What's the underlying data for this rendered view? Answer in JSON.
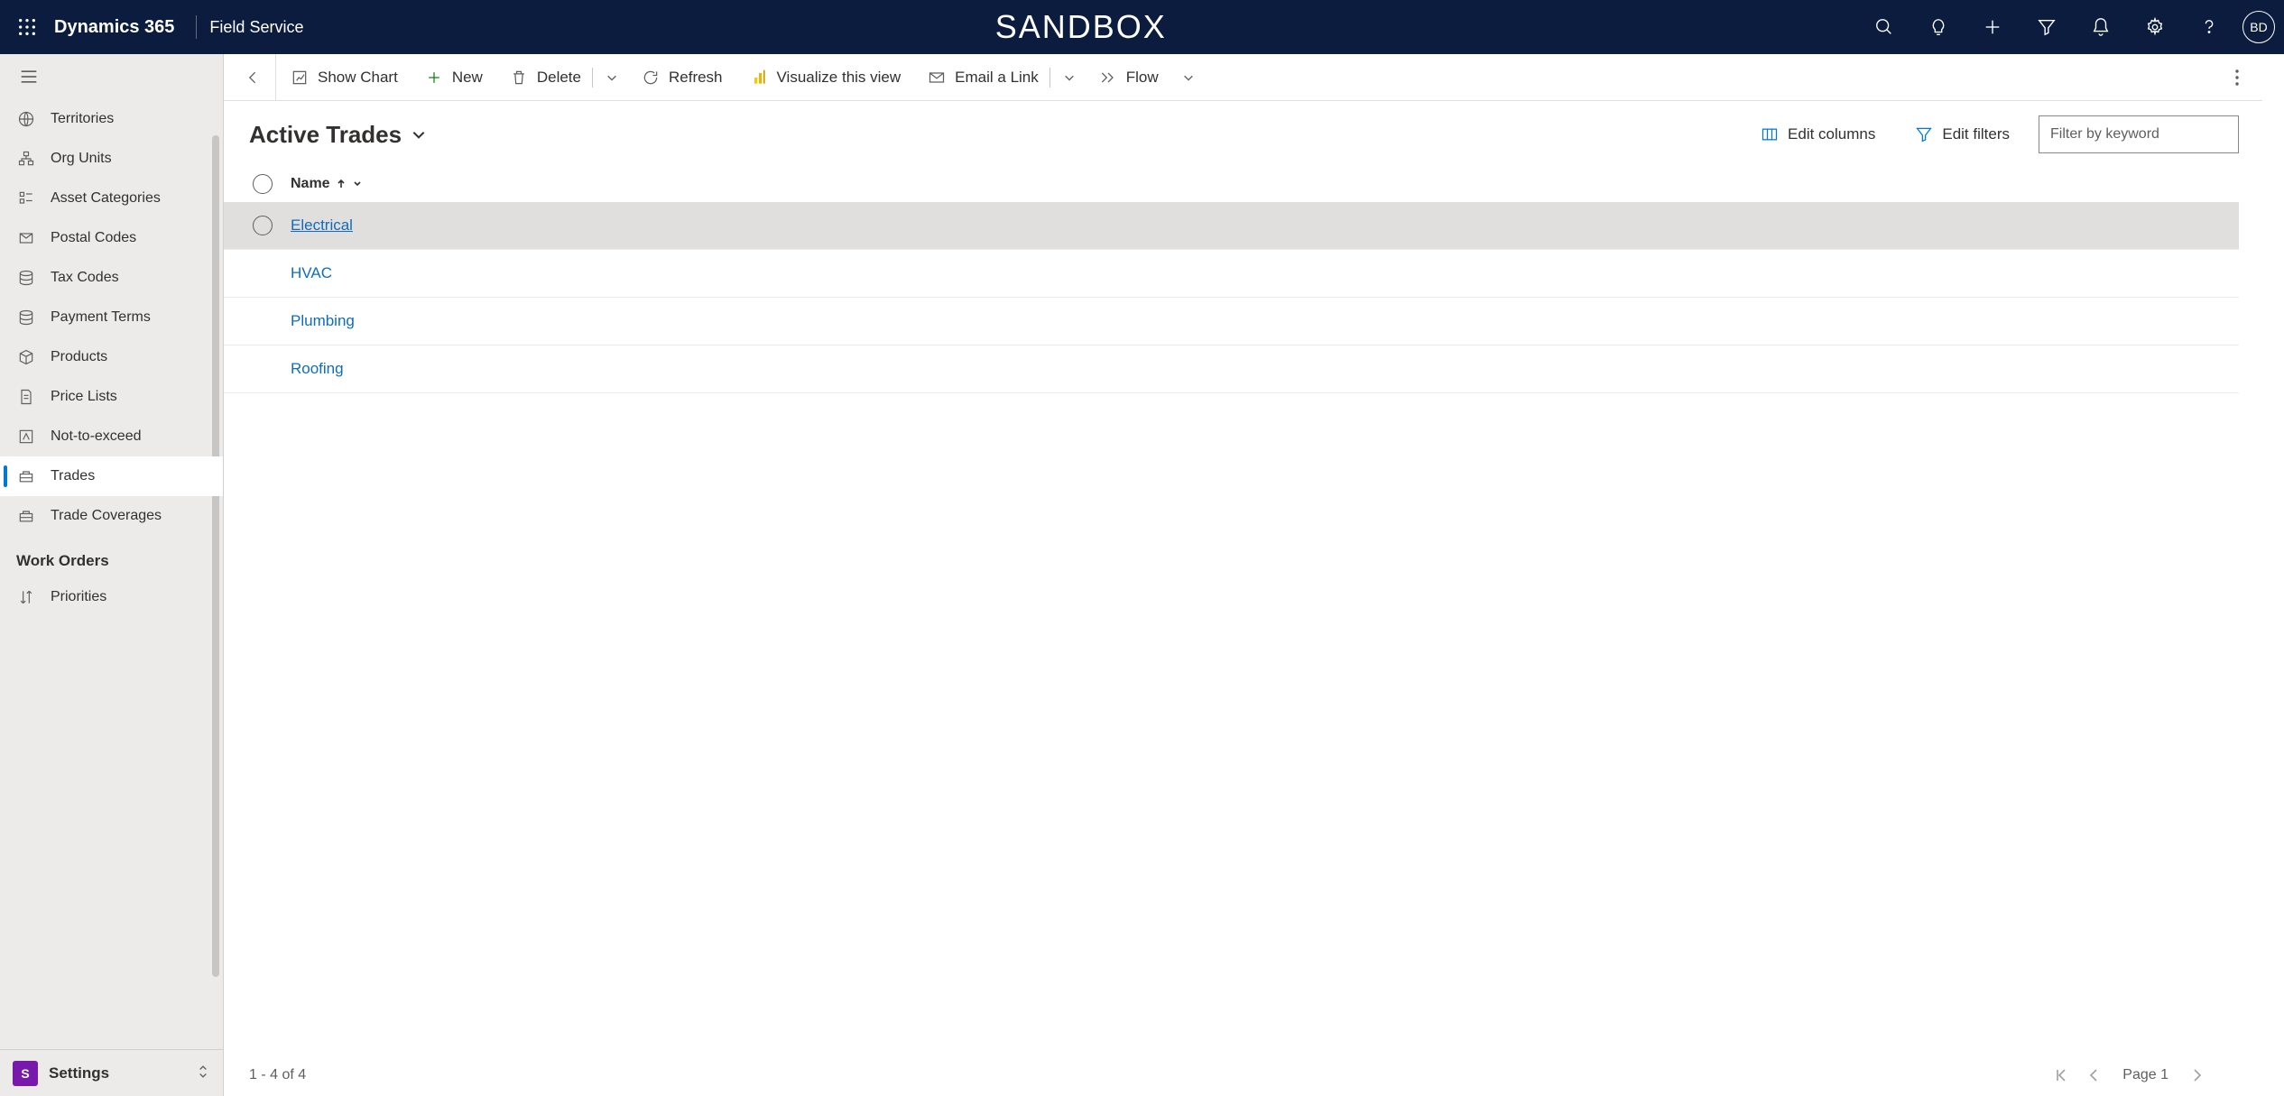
{
  "topbar": {
    "brand": "Dynamics 365",
    "app": "Field Service",
    "env": "SANDBOX",
    "avatar_initials": "BD"
  },
  "sidebar": {
    "items": [
      {
        "label": "Territories"
      },
      {
        "label": "Org Units"
      },
      {
        "label": "Asset Categories"
      },
      {
        "label": "Postal Codes"
      },
      {
        "label": "Tax Codes"
      },
      {
        "label": "Payment Terms"
      },
      {
        "label": "Products"
      },
      {
        "label": "Price Lists"
      },
      {
        "label": "Not-to-exceed"
      },
      {
        "label": "Trades",
        "selected": true
      },
      {
        "label": "Trade Coverages"
      }
    ],
    "section_header": "Work Orders",
    "section_items": [
      {
        "label": "Priorities"
      }
    ],
    "area_switch": {
      "chip": "S",
      "label": "Settings"
    }
  },
  "commands": {
    "show_chart": "Show Chart",
    "new": "New",
    "delete": "Delete",
    "refresh": "Refresh",
    "visualize": "Visualize this view",
    "email_link": "Email a Link",
    "flow": "Flow"
  },
  "view": {
    "title": "Active Trades",
    "edit_columns": "Edit columns",
    "edit_filters": "Edit filters",
    "filter_placeholder": "Filter by keyword",
    "column_name": "Name",
    "rows": [
      {
        "name": "Electrical",
        "hovered": true
      },
      {
        "name": "HVAC"
      },
      {
        "name": "Plumbing"
      },
      {
        "name": "Roofing"
      }
    ],
    "footer_count": "1 - 4 of 4",
    "page_label": "Page 1"
  }
}
